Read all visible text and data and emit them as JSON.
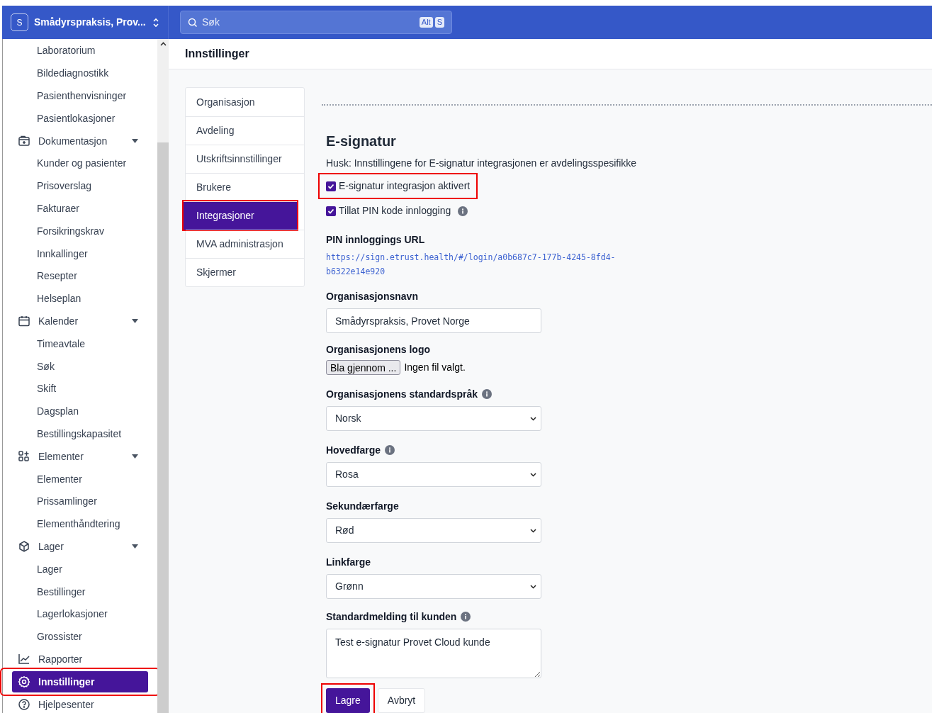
{
  "topbar": {
    "org_initial": "S",
    "org_name": "Smådyrspraksis, Prov...",
    "search": {
      "placeholder": "Søk",
      "shortcut": [
        "Alt",
        "S"
      ]
    }
  },
  "sidebar": {
    "items": [
      {
        "kind": "item",
        "label": "Laboratorium",
        "selected": false
      },
      {
        "kind": "item",
        "label": "Bildediagnostikk",
        "selected": false
      },
      {
        "kind": "item",
        "label": "Pasienthenvisninger",
        "selected": false
      },
      {
        "kind": "item",
        "label": "Pasientlokasjoner",
        "selected": false
      },
      {
        "kind": "group",
        "label": "Dokumentasjon",
        "selected": false
      },
      {
        "kind": "item",
        "label": "Kunder og pasienter",
        "selected": false
      },
      {
        "kind": "item",
        "label": "Prisoverslag",
        "selected": false
      },
      {
        "kind": "item",
        "label": "Fakturaer",
        "selected": false
      },
      {
        "kind": "item",
        "label": "Forsikringskrav",
        "selected": false
      },
      {
        "kind": "item",
        "label": "Innkallinger",
        "selected": false
      },
      {
        "kind": "item",
        "label": "Resepter",
        "selected": false
      },
      {
        "kind": "item",
        "label": "Helseplan",
        "selected": false
      },
      {
        "kind": "group",
        "label": "Kalender",
        "selected": false
      },
      {
        "kind": "item",
        "label": "Timeavtale",
        "selected": false
      },
      {
        "kind": "item",
        "label": "Søk",
        "selected": false
      },
      {
        "kind": "item",
        "label": "Skift",
        "selected": false
      },
      {
        "kind": "item",
        "label": "Dagsplan",
        "selected": false
      },
      {
        "kind": "item",
        "label": "Bestillingskapasitet",
        "selected": false
      },
      {
        "kind": "group",
        "label": "Elementer",
        "selected": false
      },
      {
        "kind": "item",
        "label": "Elementer",
        "selected": false
      },
      {
        "kind": "item",
        "label": "Prissamlinger",
        "selected": false
      },
      {
        "kind": "item",
        "label": "Elementhåndtering",
        "selected": false
      },
      {
        "kind": "group",
        "label": "Lager",
        "selected": false
      },
      {
        "kind": "item",
        "label": "Lager",
        "selected": false
      },
      {
        "kind": "item",
        "label": "Bestillinger",
        "selected": false
      },
      {
        "kind": "item",
        "label": "Lagerlokasjoner",
        "selected": false
      },
      {
        "kind": "item",
        "label": "Grossister",
        "selected": false
      },
      {
        "kind": "link",
        "label": "Rapporter",
        "selected": false
      },
      {
        "kind": "link",
        "label": "Innstillinger",
        "selected": true
      },
      {
        "kind": "link",
        "label": "Hjelpesenter",
        "selected": false
      }
    ]
  },
  "page_title": "Innstillinger",
  "tabs": [
    {
      "label": "Organisasjon",
      "selected": false
    },
    {
      "label": "Avdeling",
      "selected": false
    },
    {
      "label": "Utskriftsinnstillinger",
      "selected": false
    },
    {
      "label": "Brukere",
      "selected": false
    },
    {
      "label": "Integrasjoner",
      "selected": true
    },
    {
      "label": "MVA administrasjon",
      "selected": false
    },
    {
      "label": "Skjermer",
      "selected": false
    }
  ],
  "section": {
    "title": "E-signatur",
    "note": "Husk: Innstillingene for E-signatur integrasjonen er avdelingsspesifikke",
    "checkboxes": [
      {
        "label": "E-signatur integrasjon aktivert",
        "checked": true,
        "info": false
      },
      {
        "label": "Tillat PIN kode innlogging",
        "checked": true,
        "info": true
      }
    ],
    "fields": [
      {
        "kind": "link",
        "label": "PIN innloggings URL",
        "value": "https://sign.etrust.health/#/login/a0b687c7-177b-4245-8fd4-b6322e14e920"
      },
      {
        "kind": "text",
        "label": "Organisasjonsnavn",
        "value": "Smådyrspraksis, Provet Norge"
      },
      {
        "kind": "file",
        "label": "Organisasjonens logo",
        "button": "Bla gjennom ...",
        "status": "Ingen fil valgt."
      },
      {
        "kind": "select",
        "label": "Organisasjonens standardspråk",
        "info": true,
        "value": "Norsk"
      },
      {
        "kind": "select",
        "label": "Hovedfarge",
        "info": true,
        "value": "Rosa"
      },
      {
        "kind": "select",
        "label": "Sekundærfarge",
        "value": "Rød"
      },
      {
        "kind": "select",
        "label": "Linkfarge",
        "value": "Grønn"
      },
      {
        "kind": "textarea",
        "label": "Standardmelding til kunden",
        "info": true,
        "value": "Test e-signatur Provet Cloud kunde"
      }
    ],
    "buttons": [
      {
        "label": "Lagre",
        "primary": true
      },
      {
        "label": "Avbryt",
        "primary": false
      }
    ]
  }
}
